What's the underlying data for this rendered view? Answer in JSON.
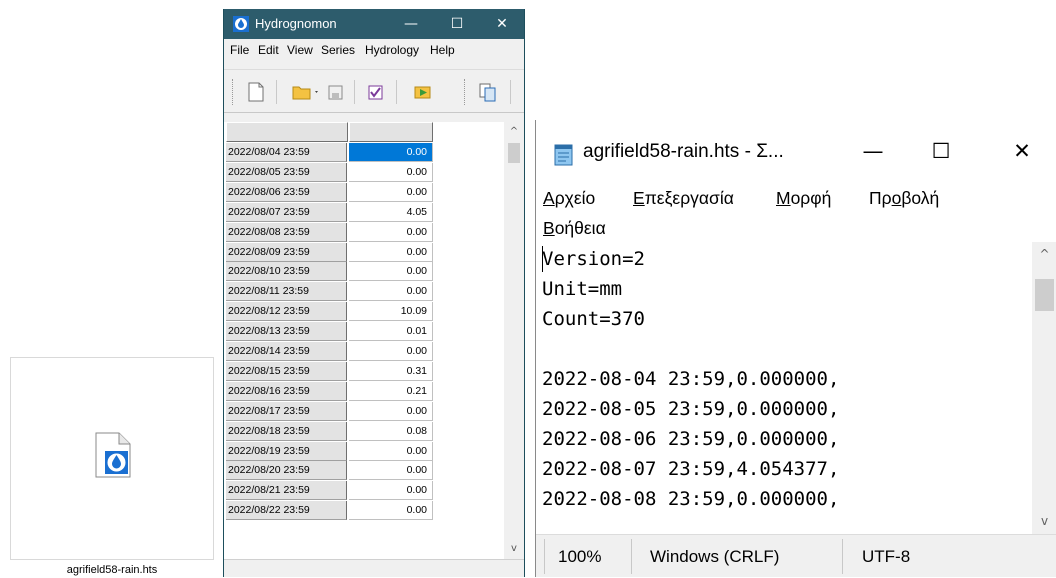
{
  "desktop": {
    "file_name": "agrifield58-rain.hts"
  },
  "hydrognomon": {
    "title": "Hydrognomon",
    "window_buttons": {
      "minimize": "—",
      "maximize": "☐",
      "close": "✕"
    },
    "menu": [
      "File",
      "Edit",
      "View",
      "Series",
      "Hydrology",
      "Help"
    ],
    "toolbar_icons": [
      "new-file-icon",
      "open-folder-icon",
      "save-icon",
      "check-icon",
      "refresh-icon",
      "copy-icon"
    ],
    "rows": [
      {
        "date": "2022/08/04 23:59",
        "value": "0.00",
        "selected": true
      },
      {
        "date": "2022/08/05 23:59",
        "value": "0.00"
      },
      {
        "date": "2022/08/06 23:59",
        "value": "0.00"
      },
      {
        "date": "2022/08/07 23:59",
        "value": "4.05"
      },
      {
        "date": "2022/08/08 23:59",
        "value": "0.00"
      },
      {
        "date": "2022/08/09 23:59",
        "value": "0.00"
      },
      {
        "date": "2022/08/10 23:59",
        "value": "0.00"
      },
      {
        "date": "2022/08/11 23:59",
        "value": "0.00"
      },
      {
        "date": "2022/08/12 23:59",
        "value": "10.09"
      },
      {
        "date": "2022/08/13 23:59",
        "value": "0.01"
      },
      {
        "date": "2022/08/14 23:59",
        "value": "0.00"
      },
      {
        "date": "2022/08/15 23:59",
        "value": "0.31"
      },
      {
        "date": "2022/08/16 23:59",
        "value": "0.21"
      },
      {
        "date": "2022/08/17 23:59",
        "value": "0.00"
      },
      {
        "date": "2022/08/18 23:59",
        "value": "0.08"
      },
      {
        "date": "2022/08/19 23:59",
        "value": "0.00"
      },
      {
        "date": "2022/08/20 23:59",
        "value": "0.00"
      },
      {
        "date": "2022/08/21 23:59",
        "value": "0.00"
      },
      {
        "date": "2022/08/22 23:59",
        "value": "0.00"
      }
    ],
    "scroll_arrows": {
      "up": "^",
      "down": "v"
    }
  },
  "notepad": {
    "title": "agrifield58-rain.hts - Σ...",
    "window_buttons": {
      "minimize": "—",
      "maximize": "☐",
      "close": "✕"
    },
    "menu": [
      {
        "pre": "",
        "key": "Α",
        "post": "ρχείο"
      },
      {
        "pre": "",
        "key": "Ε",
        "post": "πεξεργασία"
      },
      {
        "pre": "",
        "key": "Μ",
        "post": "ορφή"
      },
      {
        "pre": "Πρ",
        "key": "ο",
        "post": "βολή"
      },
      {
        "pre": "",
        "key": "Β",
        "post": "οήθεια"
      }
    ],
    "lines": [
      "Version=2",
      "Unit=mm",
      "Count=370",
      "",
      "2022-08-04 23:59,0.000000,",
      "2022-08-05 23:59,0.000000,",
      "2022-08-06 23:59,0.000000,",
      "2022-08-07 23:59,4.054377,",
      "2022-08-08 23:59,0.000000,"
    ],
    "scroll_arrows": {
      "up": "^",
      "down": "v"
    },
    "status": {
      "zoom": "100%",
      "line_endings": "Windows (CRLF)",
      "encoding": "UTF-8"
    }
  }
}
